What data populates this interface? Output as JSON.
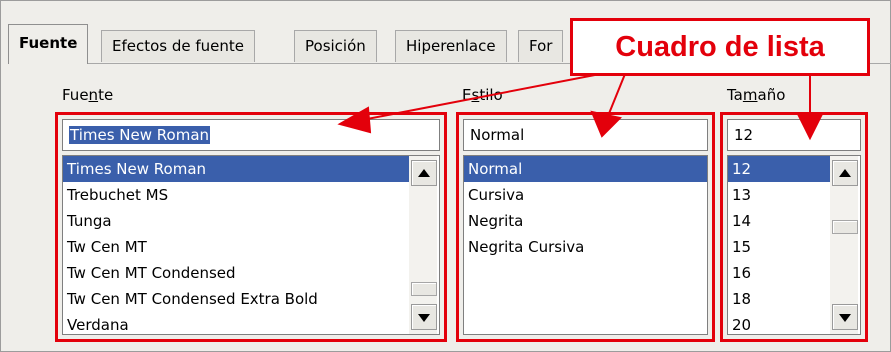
{
  "tabs": [
    {
      "label": "Fuente",
      "active": true
    },
    {
      "label": "Efectos de fuente",
      "active": false
    },
    {
      "label": "Posición",
      "active": false
    },
    {
      "label": "Hiperenlace",
      "active": false
    },
    {
      "label": "For",
      "active": false
    }
  ],
  "font": {
    "label_prefix": "Fue",
    "label_accel": "n",
    "label_suffix": "te",
    "value": "Times New Roman",
    "items": [
      "Times New Roman",
      "Trebuchet MS",
      "Tunga",
      "Tw Cen MT",
      "Tw Cen MT Condensed",
      "Tw Cen MT Condensed Extra Bold",
      "Verdana"
    ],
    "selected_index": 0
  },
  "style": {
    "label_prefix": "E",
    "label_accel": "s",
    "label_suffix": "tilo",
    "value": "Normal",
    "items": [
      "Normal",
      "Cursiva",
      "Negrita",
      "Negrita Cursiva"
    ],
    "selected_index": 0
  },
  "size": {
    "label_prefix": "Ta",
    "label_accel": "m",
    "label_suffix": "año",
    "value": "12",
    "items": [
      "12",
      "13",
      "14",
      "15",
      "16",
      "18",
      "20"
    ],
    "selected_index": 0
  },
  "annotation": {
    "text": "Cuadro de lista",
    "color": "#e3000b"
  },
  "colors": {
    "selection": "#3a5fab",
    "background": "#efeeea"
  }
}
